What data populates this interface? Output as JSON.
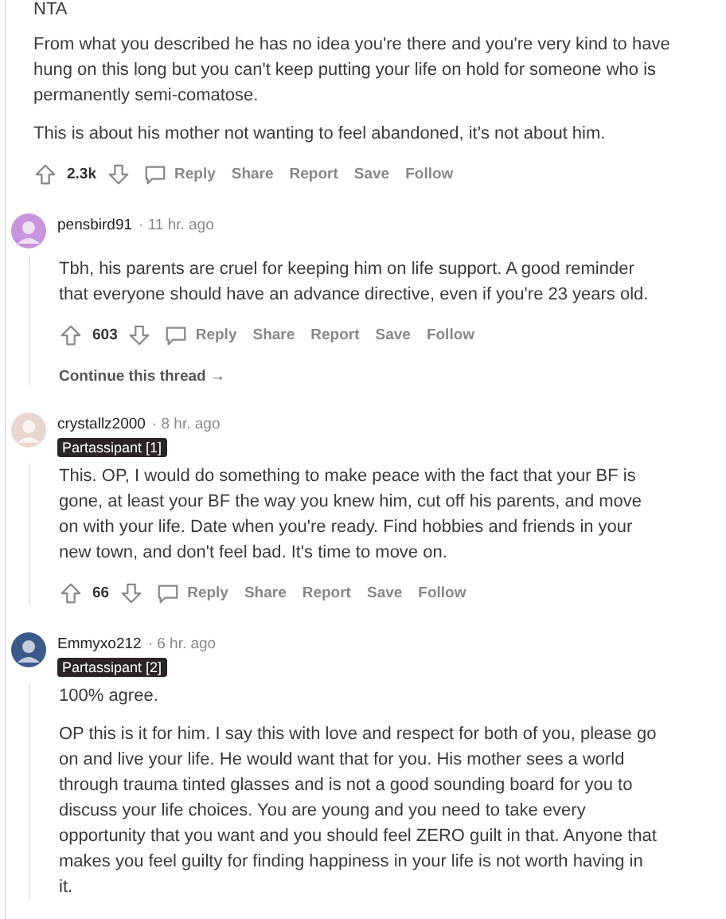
{
  "top_comment": {
    "heading": "NTA",
    "paragraphs": [
      "From what you described he has no idea you're there and you're very kind to have hung on this long but you can't keep putting your life on hold for someone who is permanently semi-comatose.",
      "This is about his mother not wanting to feel abandoned, it's not about him."
    ],
    "votes": "2.3k",
    "actions": [
      "Reply",
      "Share",
      "Report",
      "Save",
      "Follow"
    ]
  },
  "replies": [
    {
      "author": "pensbird91",
      "time": "· 11 hr. ago",
      "color": "#c894dc",
      "paragraphs": [
        "Tbh, his parents are cruel for keeping him on life support. A good reminder that everyone should have an advance directive, even if you're 23 years old."
      ],
      "votes": "603",
      "actions": [
        "Reply",
        "Share",
        "Report",
        "Save",
        "Follow"
      ],
      "continue": "Continue this thread →"
    },
    {
      "author": "crystallz2000",
      "time": "· 8 hr. ago",
      "color": "#e8d6d0",
      "flair": "Partassipant [1]",
      "paragraphs": [
        "This. OP, I would do something to make peace with the fact that your BF is gone, at least your BF the way you knew him, cut off his parents, and move on with your life. Date when you're ready. Find hobbies and friends in your new town, and don't feel bad. It's time to move on."
      ],
      "votes": "66",
      "actions": [
        "Reply",
        "Share",
        "Report",
        "Save",
        "Follow"
      ]
    },
    {
      "author": "Emmyxo212",
      "time": "· 6 hr. ago",
      "color": "#3b5a8a",
      "flair": "Partassipant [2]",
      "paragraphs": [
        "100% agree.",
        "OP this is it for him. I say this with love and respect for both of you, please go on and live your life. He would want that for you. His mother sees a world through trauma tinted glasses and is not a good sounding board for you to discuss your life choices. You are young and you need to take every opportunity that you want and you should feel ZERO guilt in that. Anyone that makes you feel guilty for finding happiness in your life is not worth having in it."
      ]
    }
  ]
}
